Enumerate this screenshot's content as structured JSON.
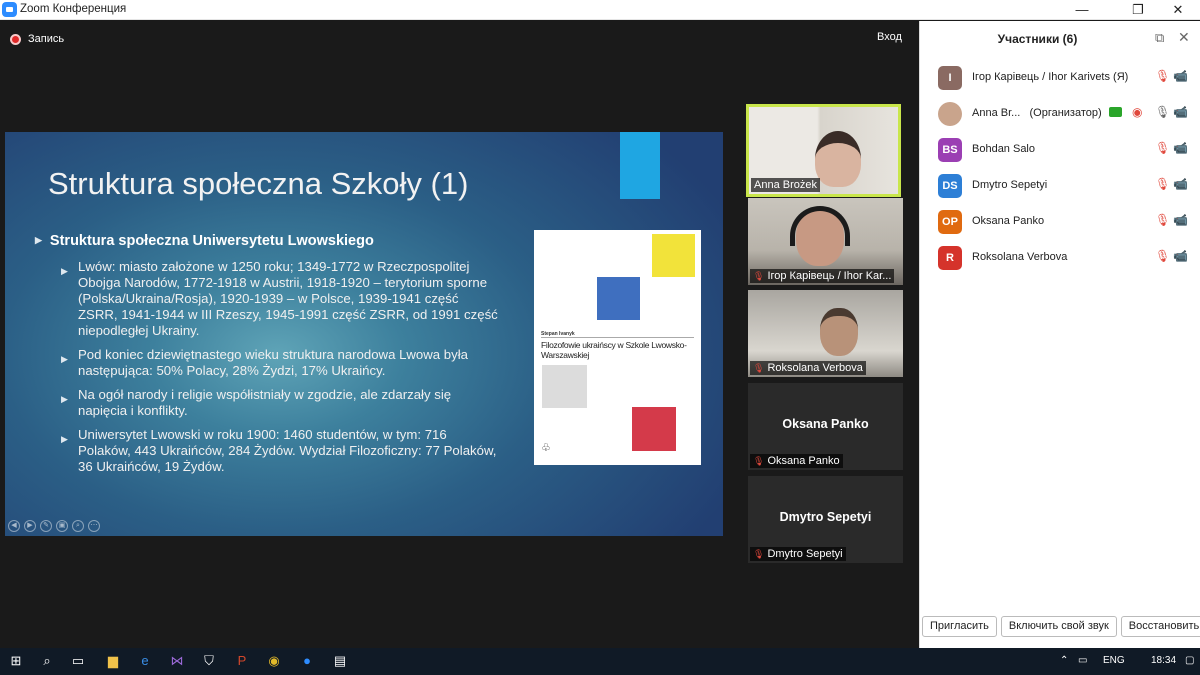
{
  "window": {
    "title": "Zoom Конференция",
    "minimize": "—",
    "maximize": "❐",
    "close": "✕"
  },
  "meeting": {
    "record_label": "Запись",
    "exit_label": "Вход"
  },
  "slide": {
    "title": "Struktura społeczna Szkoły (1)",
    "heading": "Struktura społeczna Uniwersytetu Lwowskiego",
    "bullets": [
      "Lwów: miasto założone w 1250 roku; 1349-1772 w Rzeczpospolitej Obojga Narodów, 1772-1918 w Austrii, 1918-1920 – terytorium sporne (Polska/Ukraina/Rosja), 1920-1939 – w Polsce, 1939-1941 część ZSRR, 1941-1944 w III Rzeszy, 1945-1991 część ZSRR, od 1991 część niepodległej Ukrainy.",
      "Pod koniec dziewiętnastego wieku struktura narodowa Lwowa była następująca: 50% Polacy, 28% Żydzi, 17% Ukraińcy.",
      "Na ogół narody i religie współistniały w zgodzie, ale zdarzały się napięcia i konflikty.",
      "Uniwersytet Lwowski w roku 1900: 1460 studentów, w tym: 716 Polaków, 443 Ukraińców, 284 Żydów. Wydział Filozoficzny: 77 Polaków, 36 Ukraińców, 19 Żydów."
    ],
    "bullet_marker": "▶",
    "book": {
      "author": "Stepan Ivanyk",
      "title": "Filozofowie ukraińscy w Szkole Lwowsko-Warszawskiej",
      "colors": {
        "yellow": "#f2e33a",
        "blue": "#3f6fbf",
        "gray": "#dcdcdc",
        "red": "#d43a4a"
      }
    }
  },
  "tiles": [
    {
      "name": "Anna Brożek",
      "type": "video"
    },
    {
      "name": "Ігор Карівець / Ihor Kar...",
      "type": "video",
      "muted": true
    },
    {
      "name": "Roksolana Verbova",
      "type": "video",
      "muted": true
    },
    {
      "name": "Oksana Panko",
      "center": "Oksana Panko",
      "type": "name",
      "muted": true
    },
    {
      "name": "Dmytro Sepetyi",
      "center": "Dmytro Sepetyi",
      "type": "name",
      "muted": true
    }
  ],
  "sidebar": {
    "title": "Участники (6)",
    "participants": [
      {
        "initials": "I",
        "name": "Ігор Карівець / Ihor Karivets (Я)",
        "color": "#8a6a62"
      },
      {
        "initials": "",
        "name": "Anna Br...",
        "role": "(Организатор)",
        "color": "#c9a48c"
      },
      {
        "initials": "BS",
        "name": "Bohdan Salo",
        "color": "#9b3fb3"
      },
      {
        "initials": "DS",
        "name": "Dmytro Sepetyi",
        "color": "#2d7fd6"
      },
      {
        "initials": "OP",
        "name": "Oksana Panko",
        "color": "#e06a10"
      },
      {
        "initials": "R",
        "name": "Roksolana Verbova",
        "color": "#d5332b"
      }
    ],
    "buttons": [
      "Пригласить",
      "Включить свой звук",
      "Восстановить"
    ]
  },
  "taskbar": {
    "language": "ENG",
    "time": "18:34"
  },
  "accent": "#2d8cff"
}
